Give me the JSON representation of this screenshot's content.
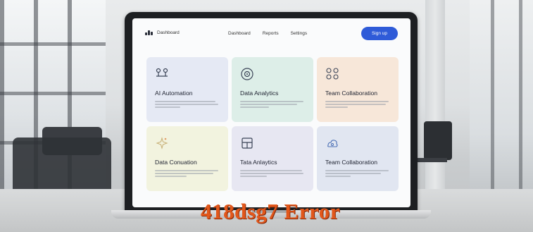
{
  "nav": {
    "logo_text": "Dashboard",
    "links": [
      "Dashboard",
      "Reports",
      "Settings"
    ],
    "signup_label": "Sign up"
  },
  "cards": [
    {
      "title": "AI Automation",
      "icon": "connected-nodes-icon"
    },
    {
      "title": "Data Analytics",
      "icon": "disc-target-icon"
    },
    {
      "title": "Team Collaboration",
      "icon": "team-people-icon"
    },
    {
      "title": "Data Conuation",
      "icon": "data-sparkle-icon"
    },
    {
      "title": "Tata Anlaytics",
      "icon": "report-board-icon"
    },
    {
      "title": "Team Collaboration",
      "icon": "team-cloud-icon"
    }
  ],
  "overlay_text": "418dsg7 Error",
  "colors": {
    "accent": "#2f5bd8",
    "overlay": "#e2571b",
    "card_backgrounds": [
      "#e5e9f4",
      "#ddeee8",
      "#f7e7d9",
      "#f2f3df",
      "#e7e7f2",
      "#e1e6f1"
    ]
  }
}
